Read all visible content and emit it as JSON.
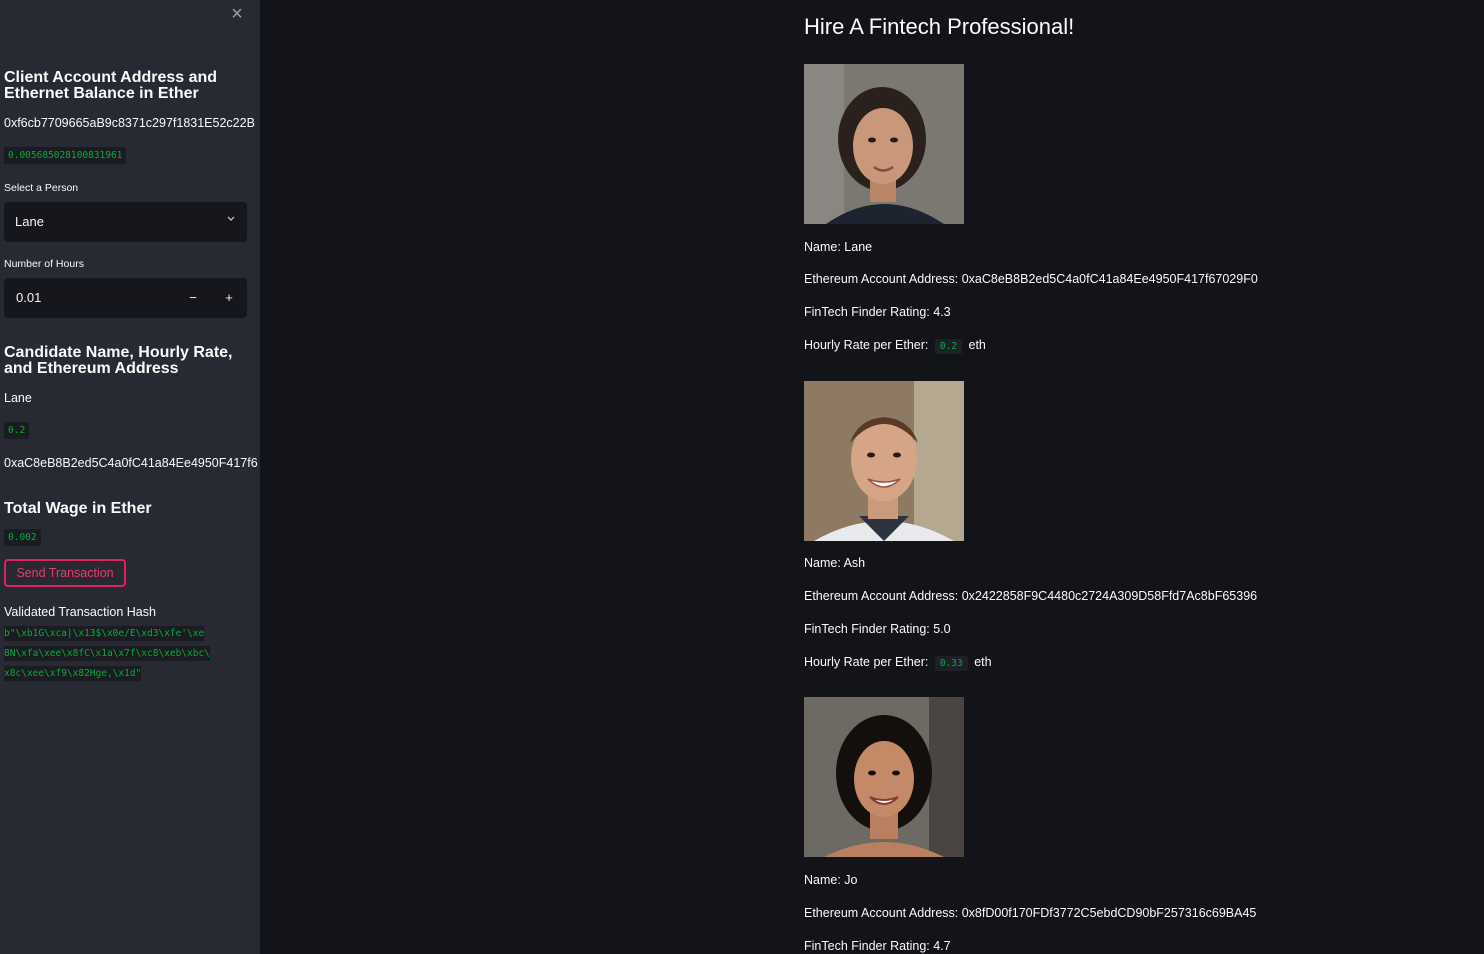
{
  "sidebar": {
    "close_icon": "close-icon",
    "client_heading": "Client Account Address and\nEthernet Balance in Ether",
    "client_address": "0xf6cb7709665aB9c8371c297f1831E52c22B",
    "client_balance": "0.005685028100831961",
    "select_label": "Select a Person",
    "select_value": "Lane",
    "hours_label": "Number of Hours",
    "hours_value": "0.01",
    "minus_label": "−",
    "plus_label": "+",
    "candidate_heading": "Candidate Name, Hourly Rate,\nand Ethereum Address",
    "candidate_name": "Lane",
    "candidate_rate": "0.2",
    "candidate_address": "0xaC8eB8B2ed5C4a0fC41a84Ee4950F417f6",
    "wage_heading": "Total Wage in Ether",
    "wage_value": "0.002",
    "send_button": "Send Transaction",
    "hash_label": "Validated Transaction Hash",
    "hash_lines": [
      "b\"\\xb1G\\xca|\\x13$\\x0e/E\\xd3\\xfe'\\xe",
      "8N\\xfa\\xee\\x8fC\\x1a\\x7f\\xc8\\xeb\\xbc\\",
      "x8c\\xee\\xf9\\x82Hge,\\x1d\""
    ]
  },
  "main": {
    "title": "Hire A Fintech Professional!",
    "candidates": [
      {
        "name": "Name: Lane",
        "address": "Ethereum Account Address: 0xaC8eB8B2ed5C4a0fC41a84Ee4950F417f67029F0",
        "rating": "FinTech Finder Rating: 4.3",
        "rate_label": "Hourly Rate per Ether:",
        "rate_value": "0.2",
        "rate_unit": "eth"
      },
      {
        "name": "Name: Ash",
        "address": "Ethereum Account Address: 0x2422858F9C4480c2724A309D58Ffd7Ac8bF65396",
        "rating": "FinTech Finder Rating: 5.0",
        "rate_label": "Hourly Rate per Ether:",
        "rate_value": "0.33",
        "rate_unit": "eth"
      },
      {
        "name": "Name: Jo",
        "address": "Ethereum Account Address: 0x8fD00f170FDf3772C5ebdCD90bF257316c69BA45",
        "rating": "FinTech Finder Rating: 4.7"
      }
    ]
  },
  "colors": {
    "sidebar_bg": "#272a33",
    "main_bg": "#131419",
    "accent": "#e0225b",
    "code_green": "#09ab3b"
  }
}
